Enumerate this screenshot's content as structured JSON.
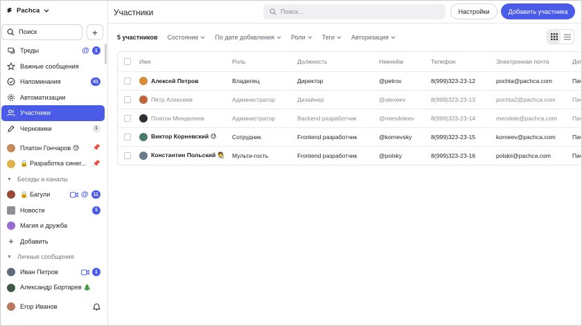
{
  "workspace": {
    "name": "Pachca"
  },
  "sidebar": {
    "search_label": "Поиск",
    "nav": [
      {
        "label": "Треды",
        "icon": "threads-icon",
        "at": "@",
        "badge": "1"
      },
      {
        "label": "Важные сообщения",
        "icon": "star-icon"
      },
      {
        "label": "Напоминания",
        "icon": "check-circle-icon",
        "badge": "41"
      },
      {
        "label": "Автоматизации",
        "icon": "gear-icon"
      },
      {
        "label": "Участники",
        "icon": "users-icon",
        "active": true
      },
      {
        "label": "Черновики",
        "icon": "pencil-icon",
        "badge_grey": "1"
      }
    ],
    "pinned": [
      {
        "label": "Платон Гончаров 😓",
        "color": "#c48a5c"
      },
      {
        "label": "🔒 Разработка синег...",
        "color": "#e0b24b"
      }
    ],
    "channels_title": "Беседы и каналы",
    "channels": [
      {
        "label": "🔒 Багули",
        "color": "#9b4a3a",
        "at": "@",
        "badge": "11",
        "video": true
      },
      {
        "label": "Новости",
        "color": "#8f8f9a",
        "badge": "1"
      },
      {
        "label": "Магия и дружба",
        "color": "#9a6bd0"
      }
    ],
    "add_label": "Добавить",
    "personal_title": "Личные сообщения",
    "personal": [
      {
        "label": "Иван Петров",
        "color": "#5b6b7a",
        "badge": "1",
        "video": true
      },
      {
        "label": "Александр Бортарев 🎄",
        "color": "#3f5a4a"
      }
    ],
    "me": {
      "label": "Егор Иванов",
      "color": "#b9785b"
    }
  },
  "header": {
    "title": "Участники",
    "search_placeholder": "Поиск...",
    "settings_label": "Настройки",
    "add_label": "Добавить участника"
  },
  "filters": {
    "count": "5 участников",
    "items": [
      "Состояние",
      "По дате добавления",
      "Роли",
      "Теги",
      "Авторизация"
    ]
  },
  "table": {
    "columns": [
      "Имя",
      "Роль",
      "Должность",
      "Никнейм",
      "Телефон",
      "Электронная почта",
      "Деп"
    ],
    "rows": [
      {
        "name": "Алексей Петров",
        "role": "Владелец",
        "position": "Директор",
        "nick": "@petrov",
        "phone": "8(999)323-23-12",
        "email": "pochta@pachca.com",
        "dept": "Пач",
        "dim": false,
        "avatar": "#d98c3a"
      },
      {
        "name": "Пётр Алексеев",
        "role": "Администратор",
        "position": "Дизайнер",
        "nick": "@alexeev",
        "phone": "8(999)323-23-13",
        "email": "pochta2@pachca.com",
        "dept": "Пач",
        "dim": true,
        "avatar": "#c0663a"
      },
      {
        "name": "Платон Менделеев",
        "role": "Администратор",
        "position": "Backend разработчик",
        "nick": "@mendeleev",
        "phone": "8(999)323-23-14",
        "email": "mendele@pachca.com",
        "dept": "Пач",
        "dim": true,
        "avatar": "#2f2f35"
      },
      {
        "name": "Виктор Корневский 😓",
        "role": "Сотрудник",
        "position": "Frontend разработчик",
        "nick": "@kornevsky",
        "phone": "8(999)323-23-15",
        "email": "korneev@pachca.com",
        "dept": "Пач",
        "dim": false,
        "avatar": "#4a7a6a"
      },
      {
        "name": "Константин Польский 🧑‍🎨",
        "role": "Мульти-гость",
        "position": "Frontend разработчик",
        "nick": "@polsky",
        "phone": "8(999)323-23-16",
        "email": "polskii@pachca.com",
        "dept": "Пач",
        "dim": false,
        "avatar": "#6a7a8a"
      }
    ]
  }
}
